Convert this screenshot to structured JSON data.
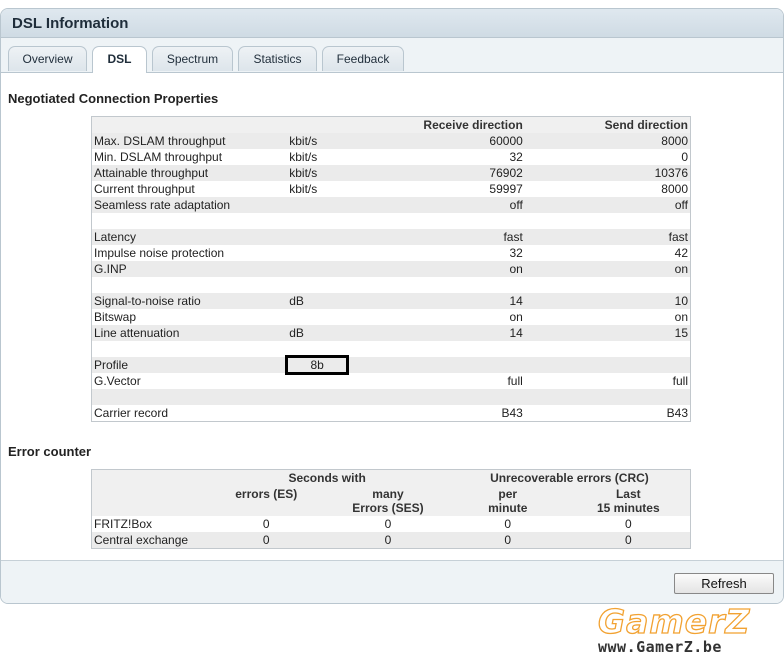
{
  "window": {
    "title": "DSL Information"
  },
  "tabs": [
    {
      "label": "Overview",
      "active": false
    },
    {
      "label": "DSL",
      "active": true
    },
    {
      "label": "Spectrum",
      "active": false
    },
    {
      "label": "Statistics",
      "active": false
    },
    {
      "label": "Feedback",
      "active": false
    }
  ],
  "connection": {
    "title": "Negotiated Connection Properties",
    "headers": {
      "receive": "Receive direction",
      "send": "Send direction"
    },
    "rows": [
      {
        "label": "Max. DSLAM throughput",
        "unit": "kbit/s",
        "receive": "60000",
        "send": "8000"
      },
      {
        "label": "Min. DSLAM throughput",
        "unit": "kbit/s",
        "receive": "32",
        "send": "0"
      },
      {
        "label": "Attainable throughput",
        "unit": "kbit/s",
        "receive": "76902",
        "send": "10376"
      },
      {
        "label": "Current throughput",
        "unit": "kbit/s",
        "receive": "59997",
        "send": "8000"
      },
      {
        "label": "Seamless rate adaptation",
        "unit": "",
        "receive": "off",
        "send": "off"
      },
      {
        "label": "",
        "unit": "",
        "receive": "",
        "send": ""
      },
      {
        "label": "Latency",
        "unit": "",
        "receive": "fast",
        "send": "fast"
      },
      {
        "label": "Impulse noise protection",
        "unit": "",
        "receive": "32",
        "send": "42"
      },
      {
        "label": "G.INP",
        "unit": "",
        "receive": "on",
        "send": "on"
      },
      {
        "label": "",
        "unit": "",
        "receive": "",
        "send": ""
      },
      {
        "label": "Signal-to-noise ratio",
        "unit": "dB",
        "receive": "14",
        "send": "10"
      },
      {
        "label": "Bitswap",
        "unit": "",
        "receive": "on",
        "send": "on"
      },
      {
        "label": "Line attenuation",
        "unit": "dB",
        "receive": "14",
        "send": "15"
      },
      {
        "label": "",
        "unit": "",
        "receive": "",
        "send": ""
      },
      {
        "label": "Profile",
        "unit": "8b",
        "receive": "",
        "send": ""
      },
      {
        "label": "G.Vector",
        "unit": "",
        "receive": "full",
        "send": "full"
      },
      {
        "label": "",
        "unit": "",
        "receive": "",
        "send": ""
      },
      {
        "label": "Carrier record",
        "unit": "",
        "receive": "B43",
        "send": "B43"
      }
    ]
  },
  "errors": {
    "title": "Error counter",
    "group_seconds": "Seconds with",
    "group_crc": "Unrecoverable errors (CRC)",
    "col_es": "errors (ES)",
    "col_ses_line1": "many",
    "col_ses_line2": "Errors (SES)",
    "col_min_line1": "per",
    "col_min_line2": "minute",
    "col_15_line1": "Last",
    "col_15_line2": "15 minutes",
    "rows": [
      {
        "label": "FRITZ!Box",
        "es": "0",
        "ses": "0",
        "per_minute": "0",
        "last15": "0"
      },
      {
        "label": "Central exchange",
        "es": "0",
        "ses": "0",
        "per_minute": "0",
        "last15": "0"
      }
    ]
  },
  "footer": {
    "refresh_label": "Refresh"
  },
  "watermark": {
    "brand": "GamerZ",
    "url": "www.GamerZ.be",
    "color": "#f2a232"
  }
}
